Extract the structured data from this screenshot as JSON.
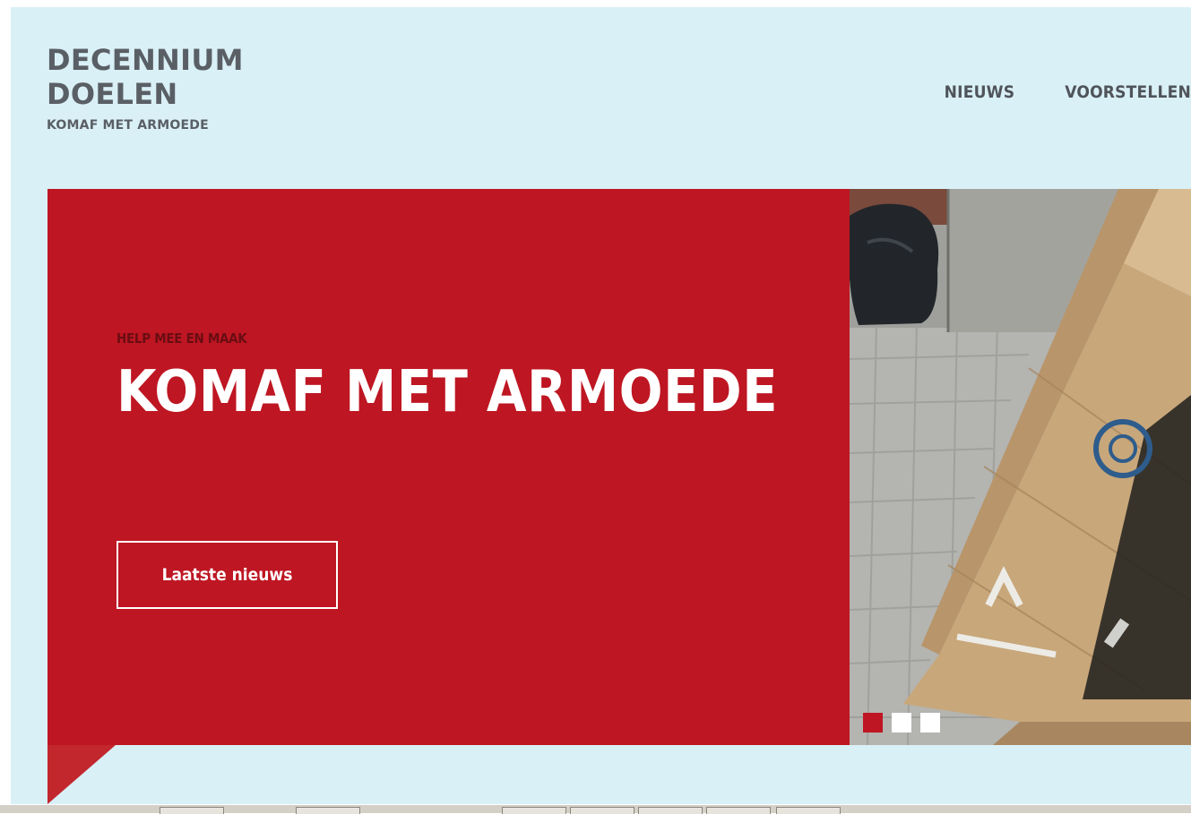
{
  "logo": {
    "line1": "DECENNIUM",
    "line2": "DOELEN",
    "tagline": "KOMAF MET ARMOEDE"
  },
  "nav": {
    "items": [
      {
        "label": "NIEUWS"
      },
      {
        "label": "VOORSTELLEN"
      }
    ]
  },
  "hero": {
    "kicker": "HELP MEE EN MAAK",
    "title": "KOMAF MET ARMOEDE",
    "button_label": "Laatste nieuws",
    "active_slide": 1,
    "slide_count": 3
  },
  "colors": {
    "background": "#d9f0f6",
    "brand_red": "#be1622",
    "logo_grey": "#5a5f66",
    "white": "#ffffff"
  }
}
